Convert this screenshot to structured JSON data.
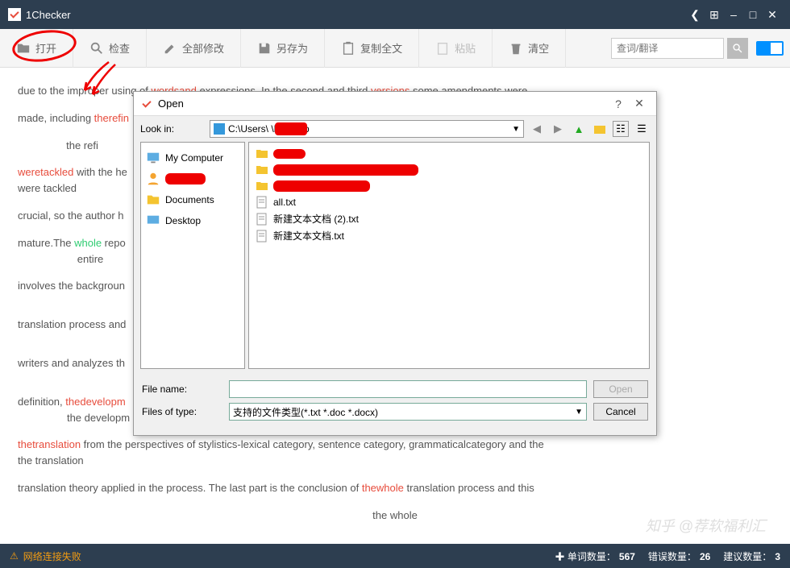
{
  "app": {
    "title": "1Checker"
  },
  "titlebar_icons": [
    "share",
    "windows",
    "minimize",
    "maximize",
    "close"
  ],
  "toolbar": {
    "open": "打开",
    "check": "检查",
    "modify_all": "全部修改",
    "save_as": "另存为",
    "copy_all": "复制全文",
    "paste": "粘贴",
    "clear": "清空"
  },
  "search": {
    "placeholder": "查词/翻译"
  },
  "text": {
    "l1a": "due to the improper using of ",
    "l1b": "wordsand",
    "l1c": " expressions. In the second and third ",
    "l1d": "versions",
    "l1e": " some amendments were",
    "l2a": "made, including ",
    "l2b": "therefin",
    "l2c": "the refi",
    "l3a": "weretackled",
    "l3b": " with the he",
    "l3c": "were tackled",
    "l4": "crucial, so the author h",
    "l5a": "mature.The ",
    "l5b": "whole",
    "l5c": " repo",
    "l5d": "entire",
    "l6": "involves the backgroun",
    "l7": "translation process and",
    "l8": "writers and analyzes th",
    "l9a": "definition, ",
    "l9b": "thedevelopm",
    "l9c": "the developm",
    "l10a": "thetranslation",
    "l10b": " from the perspectives of stylistics-lexical category, sentence category, grammaticalcategory and the",
    "l10c": "the translation",
    "l11a": "translation theory applied in the process. The last part is the conclusion of ",
    "l11b": "thewhole",
    "l11c": " translation process and this",
    "l11d": "the whole"
  },
  "dialog": {
    "title": "Open",
    "look_in": "Look in:",
    "path": "C:\\Users\\        \\Desktop",
    "sidebar": {
      "my_computer": "My Computer",
      "redacted": "",
      "documents": "Documents",
      "desktop": "Desktop"
    },
    "files": {
      "f1": "",
      "f2": "",
      "f3": "",
      "f4": "all.txt",
      "f5": "新建文本文档 (2).txt",
      "f6": "新建文本文档.txt"
    },
    "file_name_lbl": "File name:",
    "file_name_val": "",
    "file_type_lbl": "Files of type:",
    "file_type_val": "支持的文件类型(*.txt *.doc *.docx)",
    "open_btn": "Open",
    "cancel_btn": "Cancel"
  },
  "status": {
    "warning": "网络连接失败",
    "words_lbl": "单词数量：",
    "words_val": "567",
    "errors_lbl": "错误数量：",
    "errors_val": "26",
    "suggest_lbl": "建议数量：",
    "suggest_val": "3"
  },
  "watermark": "知乎 @荐软福利汇"
}
